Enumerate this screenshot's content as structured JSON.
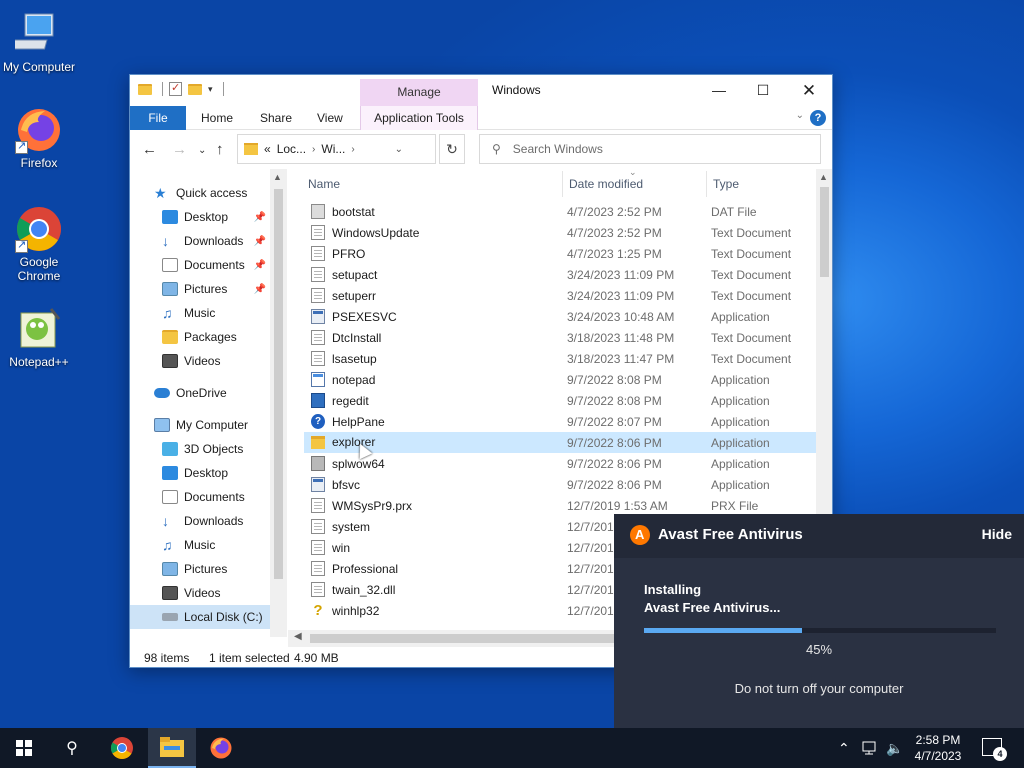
{
  "desktop": {
    "icons": [
      {
        "label": "My Computer"
      },
      {
        "label": "Firefox"
      },
      {
        "label": "Google Chrome"
      },
      {
        "label": "Notepad++"
      }
    ]
  },
  "explorer": {
    "manage_tab": "Manage",
    "title": "Windows",
    "ribbon_tabs": {
      "file": "File",
      "home": "Home",
      "share": "Share",
      "view": "View",
      "app_tools": "Application Tools"
    },
    "address": {
      "seg1": "Loc...",
      "seg2": "Wi...",
      "prefix": "«"
    },
    "search_placeholder": "Search Windows",
    "nav": {
      "quick_access": "Quick access",
      "qa_items": [
        "Desktop",
        "Downloads",
        "Documents",
        "Pictures",
        "Music",
        "Packages",
        "Videos"
      ],
      "onedrive": "OneDrive",
      "my_computer": "My Computer",
      "mc_items": [
        "3D Objects",
        "Desktop",
        "Documents",
        "Downloads",
        "Music",
        "Pictures",
        "Videos",
        "Local Disk (C:)"
      ]
    },
    "columns": {
      "name": "Name",
      "date": "Date modified",
      "type": "Type"
    },
    "files": [
      {
        "name": "bootstat",
        "date": "4/7/2023 2:52 PM",
        "type": "DAT File",
        "icon": "dat"
      },
      {
        "name": "WindowsUpdate",
        "date": "4/7/2023 2:52 PM",
        "type": "Text Document",
        "icon": "doc"
      },
      {
        "name": "PFRO",
        "date": "4/7/2023 1:25 PM",
        "type": "Text Document",
        "icon": "doc"
      },
      {
        "name": "setupact",
        "date": "3/24/2023 11:09 PM",
        "type": "Text Document",
        "icon": "doc"
      },
      {
        "name": "setuperr",
        "date": "3/24/2023 11:09 PM",
        "type": "Text Document",
        "icon": "doc"
      },
      {
        "name": "PSEXESVC",
        "date": "3/24/2023 10:48 AM",
        "type": "Application",
        "icon": "app"
      },
      {
        "name": "DtcInstall",
        "date": "3/18/2023 11:48 PM",
        "type": "Text Document",
        "icon": "doc"
      },
      {
        "name": "lsasetup",
        "date": "3/18/2023 11:47 PM",
        "type": "Text Document",
        "icon": "doc"
      },
      {
        "name": "notepad",
        "date": "9/7/2022 8:08 PM",
        "type": "Application",
        "icon": "note"
      },
      {
        "name": "regedit",
        "date": "9/7/2022 8:08 PM",
        "type": "Application",
        "icon": "reg"
      },
      {
        "name": "HelpPane",
        "date": "9/7/2022 8:07 PM",
        "type": "Application",
        "icon": "help"
      },
      {
        "name": "explorer",
        "date": "9/7/2022 8:06 PM",
        "type": "Application",
        "icon": "fold"
      },
      {
        "name": "splwow64",
        "date": "9/7/2022 8:06 PM",
        "type": "Application",
        "icon": "print"
      },
      {
        "name": "bfsvc",
        "date": "9/7/2022 8:06 PM",
        "type": "Application",
        "icon": "app"
      },
      {
        "name": "WMSysPr9.prx",
        "date": "12/7/2019 1:53 AM",
        "type": "PRX File",
        "icon": "doc"
      },
      {
        "name": "system",
        "date": "12/7/201",
        "type": "",
        "icon": "doc"
      },
      {
        "name": "win",
        "date": "12/7/201",
        "type": "",
        "icon": "doc"
      },
      {
        "name": "Professional",
        "date": "12/7/201",
        "type": "",
        "icon": "doc"
      },
      {
        "name": "twain_32.dll",
        "date": "12/7/201",
        "type": "",
        "icon": "doc"
      },
      {
        "name": "winhlp32",
        "date": "12/7/201",
        "type": "",
        "icon": "q"
      }
    ],
    "selected_file": "explorer",
    "status": {
      "count": "98 items",
      "selected": "1 item selected",
      "size": "4.90 MB"
    }
  },
  "avast": {
    "title": "Avast Free Antivirus",
    "hide": "Hide",
    "line1": "Installing",
    "line2": "Avast Free Antivirus...",
    "progress_percent": 45,
    "progress_label": "45%",
    "warning": "Do not turn off your computer",
    "accent": "#ff7800",
    "bar_color": "#5aa9f2"
  },
  "taskbar": {
    "time": "2:58 PM",
    "date": "4/7/2023",
    "notifications": "4",
    "apps": [
      "start-icon",
      "search-icon",
      "chrome-icon",
      "file-explorer-icon",
      "firefox-icon"
    ]
  }
}
